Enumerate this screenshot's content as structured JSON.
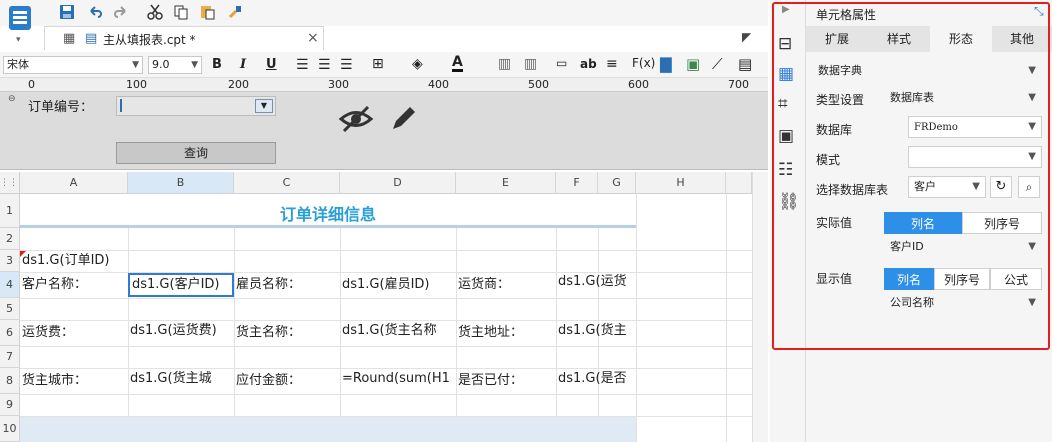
{
  "toolbar": {
    "icons": [
      "template-icon",
      "save-icon",
      "undo-icon",
      "redo-icon",
      "cut-icon",
      "copy-icon",
      "paste-icon",
      "format-brush-icon"
    ]
  },
  "tab": {
    "title": "主从填报表.cpt *",
    "close": "×"
  },
  "format": {
    "font": "宋体",
    "size": "9.0",
    "bold": "B",
    "italic": "I",
    "underline": "U",
    "text_color": "A",
    "fx_label": "F(x)",
    "ab_label": "ab"
  },
  "ruler": {
    "ticks": [
      "0",
      "100",
      "200",
      "300",
      "400",
      "500",
      "600",
      "700"
    ]
  },
  "param_pane": {
    "order_label": "订单编号：",
    "query_button": "查询"
  },
  "sheet": {
    "columns": [
      "A",
      "B",
      "C",
      "D",
      "E",
      "F",
      "G",
      "H"
    ],
    "rows": [
      "1",
      "2",
      "3",
      "4",
      "5",
      "6",
      "7",
      "8",
      "9",
      "10"
    ],
    "title": "订单详细信息",
    "cells": {
      "A3": "ds1.G(订单ID)",
      "A4": "客户名称：",
      "B4": "ds1.G(客户ID)",
      "C4": "雇员名称：",
      "D4": "ds1.G(雇员ID)",
      "E4": "运货商：",
      "F4": "ds1.G(运货",
      "A6": "运货费：",
      "B6": "ds1.G(运货费)",
      "C6": "货主名称：",
      "D6": "ds1.G(货主名称",
      "E6": "货主地址：",
      "F6": "ds1.G(货主",
      "A8": "货主城市：",
      "B8": "ds1.G(货主城",
      "C8": "应付金额：",
      "D8": "=Round(sum(H1",
      "E8": "是否已付：",
      "F8": "ds1.G(是否"
    }
  },
  "panel": {
    "title": "单元格属性",
    "tabs": [
      "扩展",
      "样式",
      "形态",
      "其他"
    ],
    "active_tab": "形态",
    "form_type": "数据字典",
    "type_label": "类型设置",
    "type_value": "数据库表",
    "db_label": "数据库",
    "db_value": "FRDemo",
    "mode_label": "模式",
    "mode_value": "",
    "table_label": "选择数据库表",
    "table_value": "客户",
    "actual_label": "实际值",
    "actual_seg": [
      "列名",
      "列序号"
    ],
    "actual_value": "客户ID",
    "display_label": "显示值",
    "display_seg": [
      "列名",
      "列序号",
      "公式"
    ],
    "display_value": "公司名称"
  },
  "colors": {
    "accent": "#2e8fe8",
    "title": "#2a9fd6",
    "highlight": "#e02020"
  }
}
